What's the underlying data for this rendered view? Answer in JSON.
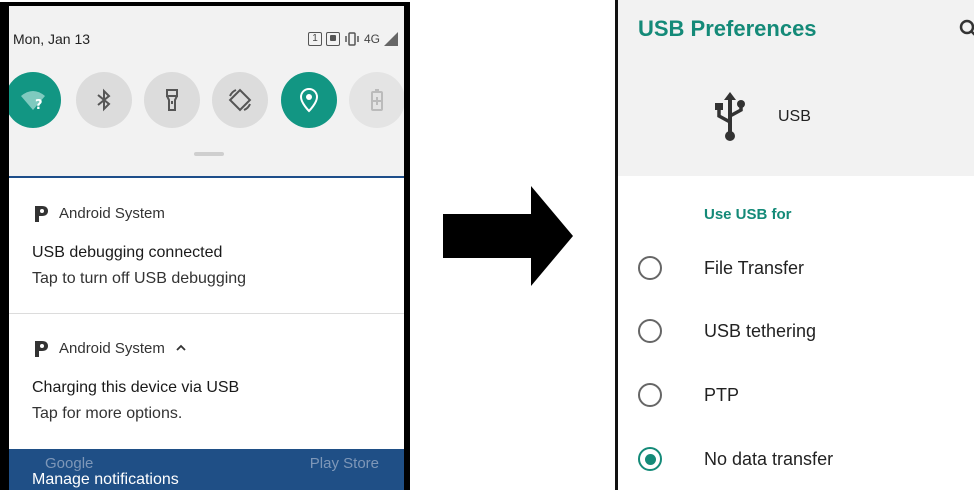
{
  "left": {
    "status": {
      "date": "Mon, Jan 13",
      "sim_slot": "1",
      "network": "4G"
    },
    "tiles": [
      {
        "icon": "wifi-question-icon",
        "active": true
      },
      {
        "icon": "bluetooth-icon",
        "active": false
      },
      {
        "icon": "flashlight-icon",
        "active": false
      },
      {
        "icon": "auto-rotate-icon",
        "active": false
      },
      {
        "icon": "location-icon",
        "active": true
      },
      {
        "icon": "battery-saver-icon",
        "active": false
      }
    ],
    "notifications": [
      {
        "app": "Android System",
        "title": "USB debugging connected",
        "text": "Tap to turn off USB debugging",
        "expanded_chevron": ""
      },
      {
        "app": "Android System",
        "title": "Charging this device via USB",
        "text": "Tap for more options.",
        "expanded_chevron": "^"
      }
    ],
    "bottom": {
      "google": "Google",
      "play_store": "Play Store",
      "manage": "Manage notifications"
    },
    "colors": {
      "accent": "#129683",
      "bar": "#1f4f86"
    }
  },
  "right": {
    "title": "USB Preferences",
    "usb_label": "USB",
    "section_title": "Use USB for",
    "options": [
      {
        "label": "File Transfer",
        "checked": false
      },
      {
        "label": "USB tethering",
        "checked": false
      },
      {
        "label": "PTP",
        "checked": false
      },
      {
        "label": "No data transfer",
        "checked": true
      }
    ],
    "colors": {
      "accent": "#148a78"
    }
  }
}
